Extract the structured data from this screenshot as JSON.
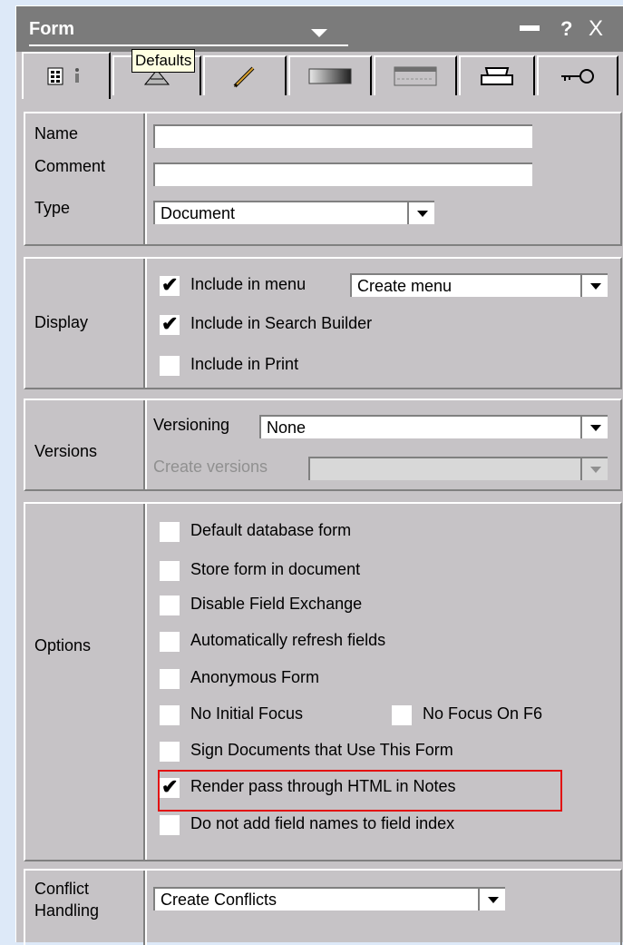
{
  "window": {
    "title": "Form",
    "help_label": "?",
    "close_label": "X",
    "tooltip": "Defaults"
  },
  "tabs": [
    {
      "icon": "info-icon",
      "selected": true
    },
    {
      "icon": "defaults-icon",
      "selected": false
    },
    {
      "icon": "pen-icon",
      "selected": false
    },
    {
      "icon": "background-icon",
      "selected": false
    },
    {
      "icon": "header-icon",
      "selected": false
    },
    {
      "icon": "printer-icon",
      "selected": false
    },
    {
      "icon": "key-icon",
      "selected": false
    }
  ],
  "basics": {
    "name_label": "Name",
    "name_value": "",
    "comment_label": "Comment",
    "comment_value": "",
    "type_label": "Type",
    "type_value": "Document"
  },
  "display": {
    "label": "Display",
    "include_menu": {
      "label": "Include in menu",
      "checked": true,
      "value": "Create menu"
    },
    "include_search": {
      "label": "Include in Search Builder",
      "checked": true
    },
    "include_print": {
      "label": "Include in Print",
      "checked": false
    }
  },
  "versions": {
    "label": "Versions",
    "versioning_label": "Versioning",
    "versioning_value": "None",
    "create_versions_label": "Create versions",
    "create_versions_value": ""
  },
  "options": {
    "label": "Options",
    "items": [
      {
        "label": "Default database form",
        "checked": false
      },
      {
        "label": "Store form in document",
        "checked": false
      },
      {
        "label": "Disable Field Exchange",
        "checked": false
      },
      {
        "label": "Automatically refresh fields",
        "checked": false
      },
      {
        "label": "Anonymous Form",
        "checked": false
      },
      {
        "label": "No Initial Focus",
        "checked": false
      },
      {
        "label": "No Focus On F6",
        "checked": false
      },
      {
        "label": "Sign Documents that Use This Form",
        "checked": false
      },
      {
        "label": "Render pass through HTML in Notes",
        "checked": true
      },
      {
        "label": "Do not add field names to field index",
        "checked": false
      }
    ]
  },
  "conflict": {
    "label_line1": "Conflict",
    "label_line2": "Handling",
    "value": "Create Conflicts"
  },
  "colors": {
    "panel": "#c6c3c6",
    "titlebar": "#7b7b7b",
    "highlight": "#e21010",
    "background": "#dde9f8"
  }
}
